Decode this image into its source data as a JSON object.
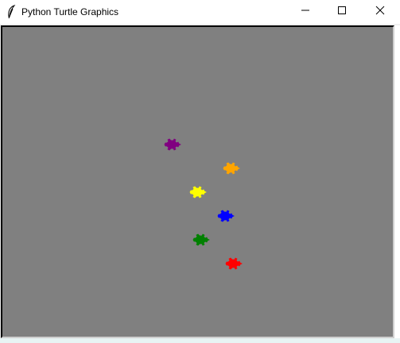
{
  "window": {
    "title": "Python Turtle Graphics",
    "app_icon": "feather-icon",
    "controls": {
      "minimize_icon": "minimize-icon",
      "maximize_icon": "maximize-icon",
      "close_icon": "close-icon"
    }
  },
  "canvas": {
    "background_color": "#808080",
    "turtles": [
      {
        "name": "purple-turtle",
        "color": "#800080",
        "heading_deg": 0
      },
      {
        "name": "orange-turtle",
        "color": "#ffa500",
        "heading_deg": 0
      },
      {
        "name": "yellow-turtle",
        "color": "#ffff00",
        "heading_deg": 0
      },
      {
        "name": "blue-turtle",
        "color": "#0000ff",
        "heading_deg": 0
      },
      {
        "name": "green-turtle",
        "color": "#008000",
        "heading_deg": 0
      },
      {
        "name": "red-turtle",
        "color": "#ff0000",
        "heading_deg": 0
      }
    ]
  }
}
